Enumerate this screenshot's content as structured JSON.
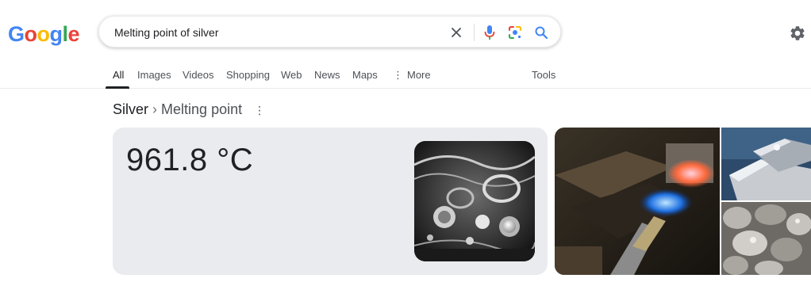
{
  "logo": {
    "letters": [
      "G",
      "o",
      "o",
      "g",
      "l",
      "e"
    ],
    "colors": [
      "#4285F4",
      "#EA4335",
      "#FBBC05",
      "#4285F4",
      "#34A853",
      "#EA4335"
    ]
  },
  "search": {
    "query": "Melting point of silver",
    "icons": [
      "close-icon",
      "microphone-icon",
      "lens-icon",
      "search-icon"
    ]
  },
  "header": {
    "settings_icon": "gear-icon"
  },
  "tabs": [
    {
      "label": "All",
      "active": true
    },
    {
      "label": "Images"
    },
    {
      "label": "Videos"
    },
    {
      "label": "Shopping"
    },
    {
      "label": "Web"
    },
    {
      "label": "News"
    },
    {
      "label": "Maps"
    },
    {
      "label": "More",
      "icon": "kebab-icon"
    },
    {
      "label": "Tools"
    }
  ],
  "knowledge": {
    "entity": "Silver",
    "separator": "›",
    "attribute": "Melting point",
    "value": "961.8 °C"
  },
  "colors": {
    "card_bg": "#e9ebee",
    "text_primary": "#202124",
    "text_secondary": "#4d5156"
  }
}
